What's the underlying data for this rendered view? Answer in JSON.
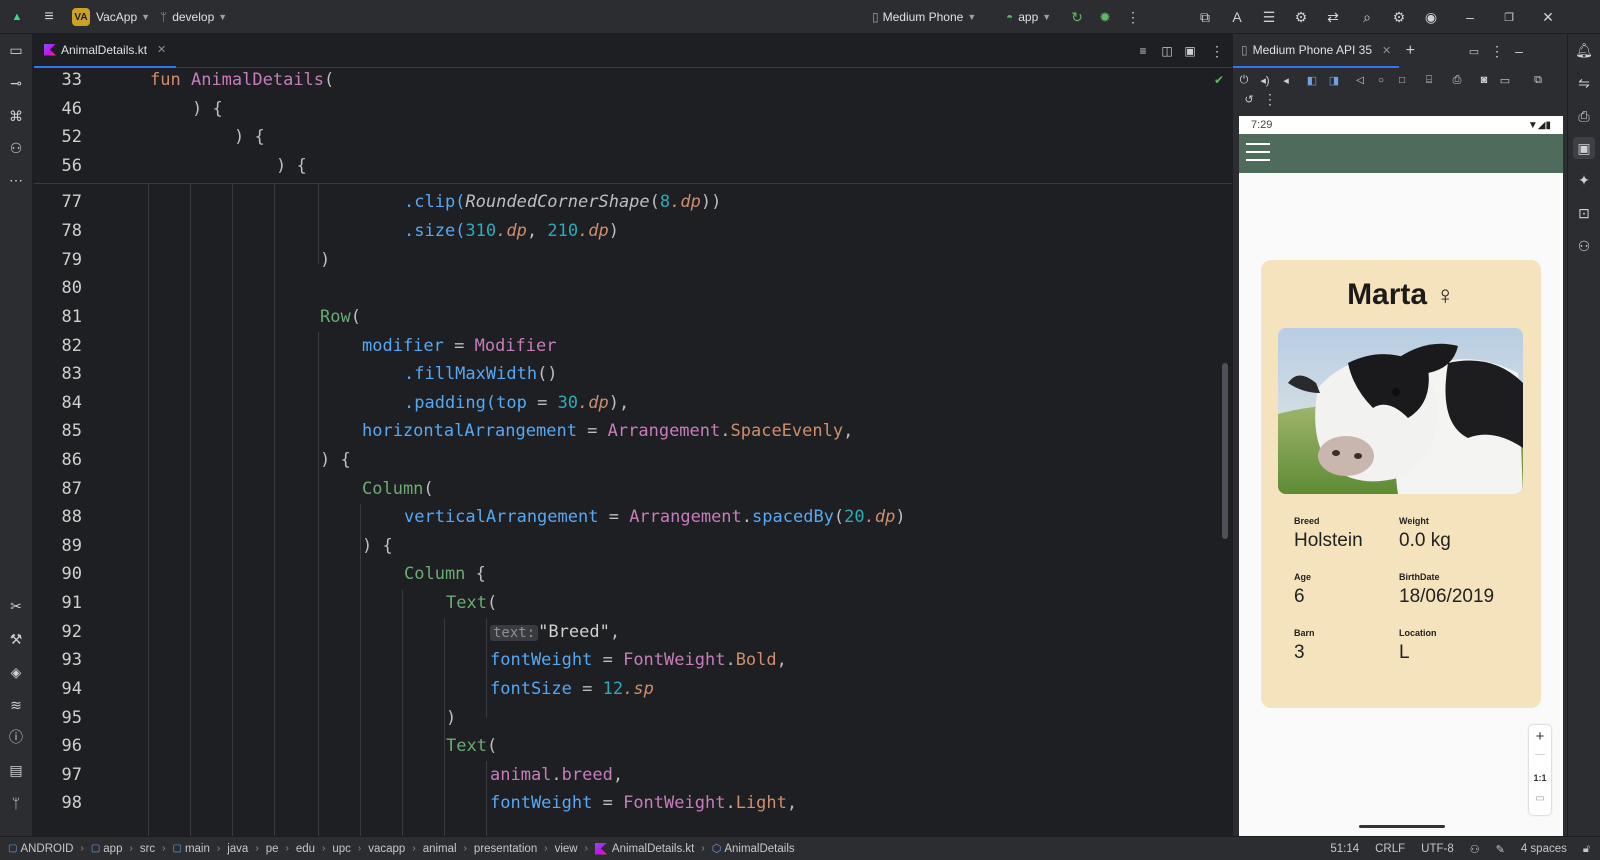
{
  "titlebar": {
    "project_badge": "VA",
    "project_name": "VacApp",
    "branch": "develop",
    "device": "Medium Phone",
    "run_config": "app"
  },
  "editor": {
    "file_tab": "AnimalDetails.kt",
    "sticky_lines": [
      {
        "num": "33"
      },
      {
        "num": "46"
      },
      {
        "num": "52"
      },
      {
        "num": "56"
      }
    ],
    "line_numbers": [
      "77",
      "78",
      "79",
      "80",
      "81",
      "82",
      "83",
      "84",
      "85",
      "86",
      "87",
      "88",
      "89",
      "90",
      "91",
      "92",
      "93",
      "94",
      "95",
      "96",
      "97",
      "98"
    ],
    "code": {
      "l33_kw": "fun",
      "l33_fn": "AnimalDetails",
      "l33_rest": "(",
      "l46": ") {",
      "l52": ") {",
      "l56": ") {",
      "l77_a": ".clip(",
      "l77_b": "RoundedCornerShape",
      "l77_c": "(",
      "l77_num": "8",
      "l77_unit": ".dp",
      "l77_end": "))",
      "l78_a": ".size(",
      "l78_n1": "310",
      "l78_u1": ".dp",
      "l78_sep": ", ",
      "l78_n2": "210",
      "l78_u2": ".dp",
      "l78_end": ")",
      "l79": ")",
      "l81_fn": "Row",
      "l81_rest": "(",
      "l82_param": "modifier",
      "l82_eq": " = ",
      "l82_val": "Modifier",
      "l83_a": ".fillMaxWidth",
      "l83_b": "()",
      "l84_a": ".padding(",
      "l84_param": "top",
      "l84_eq": " = ",
      "l84_num": "30",
      "l84_unit": ".dp",
      "l84_end": "),",
      "l85_param": "horizontalArrangement",
      "l85_eq": " = ",
      "l85_obj": "Arrangement",
      "l85_dot": ".",
      "l85_val": "SpaceEvenly",
      "l85_end": ",",
      "l86": ") {",
      "l87_fn": "Column",
      "l87_rest": "(",
      "l88_param": "verticalArrangement",
      "l88_eq": " = ",
      "l88_obj": "Arrangement",
      "l88_dot": ".",
      "l88_fn": "spacedBy",
      "l88_b": "(",
      "l88_num": "20",
      "l88_unit": ".dp",
      "l88_end": ")",
      "l89": ") {",
      "l90_fn": "Column",
      "l90_rest": " {",
      "l91_fn": "Text",
      "l91_rest": "(",
      "l92_hint": "text:",
      "l92_str": "\"Breed\"",
      "l92_end": ",",
      "l93_param": "fontWeight",
      "l93_eq": " = ",
      "l93_obj": "FontWeight",
      "l93_dot": ".",
      "l93_val": "Bold",
      "l93_end": ",",
      "l94_param": "fontSize",
      "l94_eq": " = ",
      "l94_num": "12",
      "l94_unit": ".sp",
      "l95": ")",
      "l96_fn": "Text",
      "l96_rest": "(",
      "l97_obj": "animal",
      "l97_dot": ".",
      "l97_prop": "breed",
      "l97_end": ",",
      "l98_param": "fontWeight",
      "l98_eq": " = ",
      "l98_obj": "FontWeight",
      "l98_dot": ".",
      "l98_val": "Light",
      "l98_end": ","
    }
  },
  "device_panel": {
    "tab_label": "Medium Phone API 35",
    "status_time": "7:29",
    "animal": {
      "name": "Marta",
      "sex_symbol": "♀",
      "fields": [
        {
          "label": "Breed",
          "value": "Holstein"
        },
        {
          "label": "Weight",
          "value": "0.0 kg"
        },
        {
          "label": "Age",
          "value": "6"
        },
        {
          "label": "BirthDate",
          "value": "18/06/2019"
        },
        {
          "label": "Barn",
          "value": "3"
        },
        {
          "label": "Location",
          "value": "L"
        }
      ]
    },
    "zoom": {
      "plus": "+",
      "minus": "—",
      "ratio": "1:1"
    }
  },
  "statusbar": {
    "breadcrumbs": [
      "ANDROID",
      "app",
      "src",
      "main",
      "java",
      "pe",
      "edu",
      "upc",
      "vacapp",
      "animal",
      "presentation",
      "view",
      "AnimalDetails.kt",
      "AnimalDetails"
    ],
    "position": "51:14",
    "line_sep": "CRLF",
    "encoding": "UTF-8",
    "indent": "4 spaces"
  },
  "colors": {
    "accent": "#3574f0",
    "app_bar": "#4f6b5c",
    "card": "#f5e3bd"
  }
}
